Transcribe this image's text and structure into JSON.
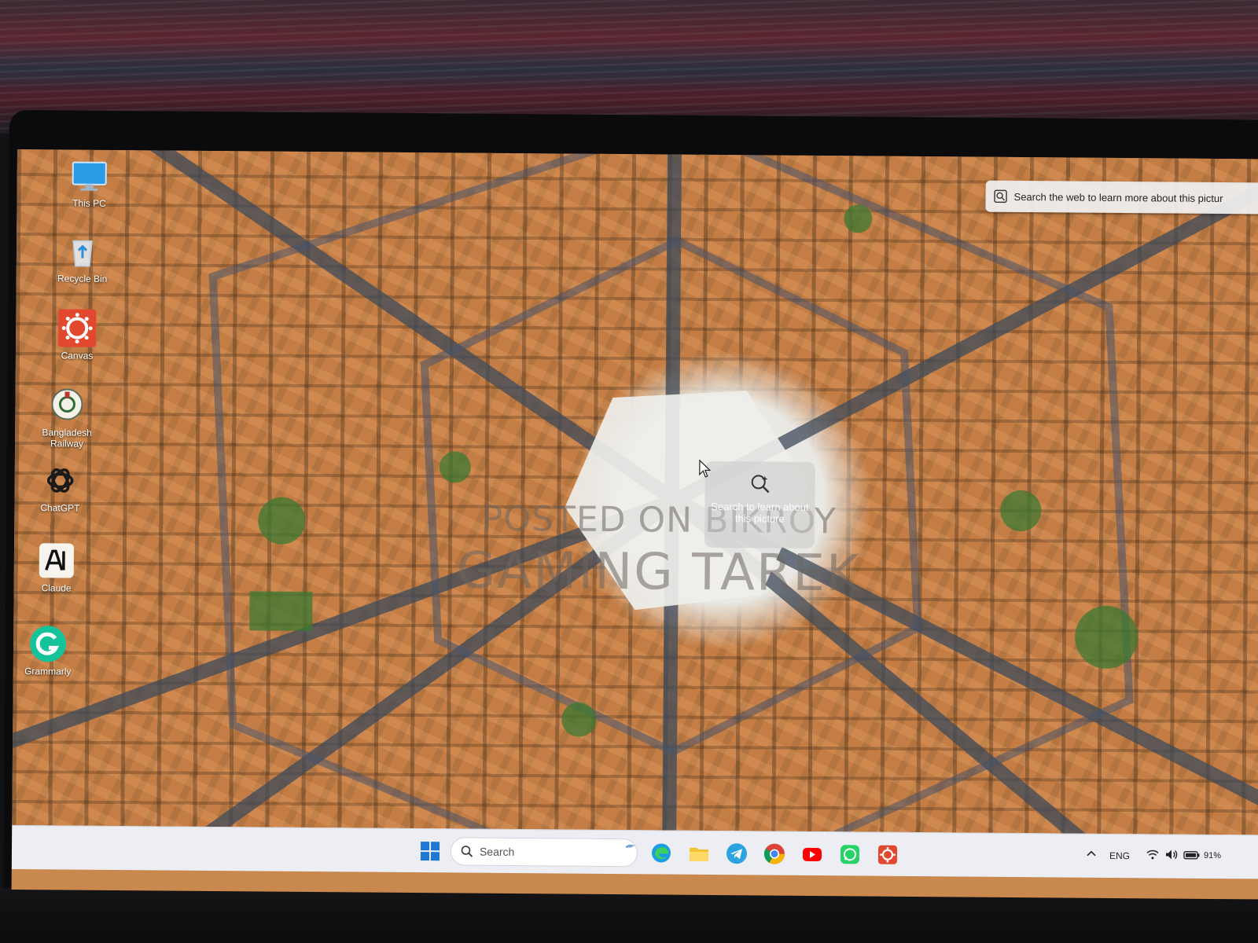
{
  "desktop": {
    "icons": [
      {
        "label": "This PC",
        "icon": "this-pc-icon"
      },
      {
        "label": "Recycle Bin",
        "icon": "recycle-bin-icon"
      },
      {
        "label": "Canvas",
        "icon": "canvas-icon"
      },
      {
        "label": "Bangladesh\nRailway",
        "icon": "bangladesh-railway-icon"
      },
      {
        "label": "ChatGPT",
        "icon": "chatgpt-icon"
      },
      {
        "label": "Claude",
        "icon": "claude-icon"
      },
      {
        "label": "Grammarly",
        "icon": "grammarly-icon"
      }
    ]
  },
  "visual_search": {
    "bar_text": "Search the web to learn more about this pictur",
    "badge_text": "Search to learn about this picture"
  },
  "watermark": {
    "line1": "POSTED ON BIKROY",
    "line2": "GAMING TAREK"
  },
  "taskbar": {
    "search_placeholder": "Search",
    "apps": [
      "start-icon",
      "edge-icon",
      "file-explorer-icon",
      "telegram-icon",
      "chrome-icon",
      "youtube-icon",
      "whatsapp-icon",
      "canvas-icon"
    ],
    "language": "ENG",
    "battery": "91%"
  },
  "colors": {
    "taskbar_bg": "#eceef3",
    "windows_blue": "#1f78d1",
    "canvas_red": "#e2482d",
    "grammarly_green": "#15c39a"
  }
}
